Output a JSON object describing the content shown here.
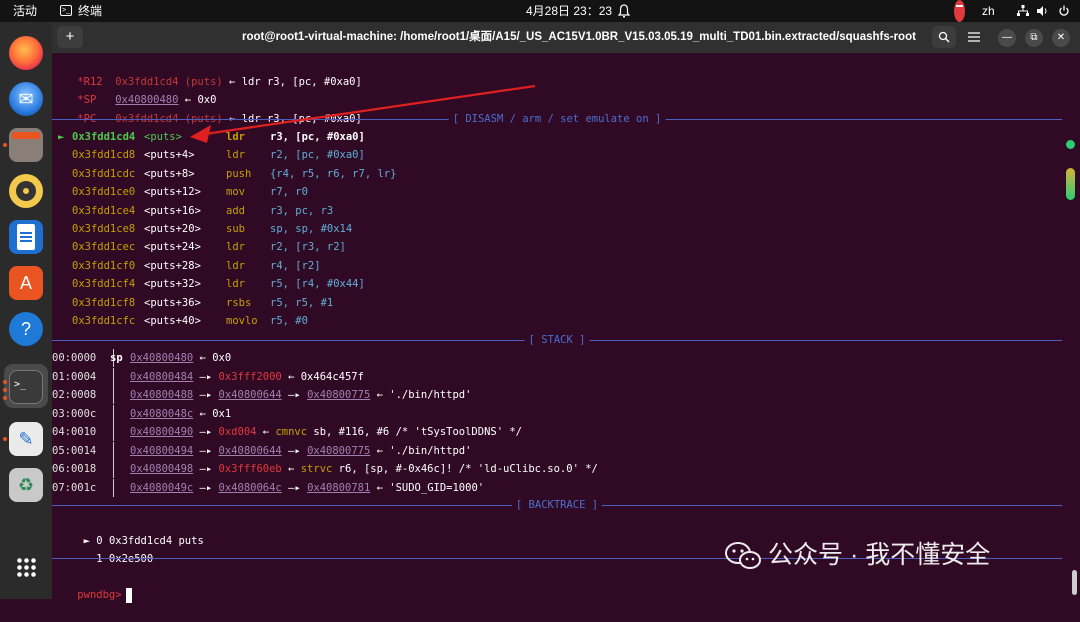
{
  "topbar": {
    "activities": "活动",
    "app_name": "终端",
    "clock": "4月28日 23：23",
    "lang": "zh"
  },
  "dock": {
    "items": [
      "firefox",
      "thunderbird",
      "files",
      "rhythmbox",
      "libreoffice-writer",
      "app-center",
      "help",
      "terminal",
      "text-editor",
      "trash",
      "show-apps"
    ]
  },
  "window": {
    "new_tab_icon": "+",
    "title": "root@root1-virtual-machine: /home/root1/桌面/A15/_US_AC15V1.0BR_V15.03.05.19_multi_TD01.bin.extracted/squashfs-root",
    "search_icon": "search-icon",
    "menu_icon": "hamburger-icon"
  },
  "registers": [
    {
      "name": "*R12",
      "addr": "0x3fdd1cd4 (puts)",
      "arrow": "←",
      "rest": "ldr r3, [pc, #0xa0]"
    },
    {
      "name": "*SP",
      "addr": "0x40800480",
      "arrow": "←",
      "rest": "0x0"
    },
    {
      "name": "*PC",
      "addr": "0x3fdd1cd4 (puts)",
      "arrow": "←",
      "rest": "ldr r3, [pc, #0xa0]"
    }
  ],
  "disasm": {
    "header": "[ DISASM / arm / set emulate on ]",
    "rows": [
      {
        "marker": "►",
        "addr": "0x3fdd1cd4",
        "sym": "<puts>",
        "op": "ldr",
        "args": "r3, [pc, #0xa0]",
        "current": true
      },
      {
        "marker": "",
        "addr": "0x3fdd1cd8",
        "sym": "<puts+4>",
        "op": "ldr",
        "args": "r2, [pc, #0xa0]",
        "current": false
      },
      {
        "marker": "",
        "addr": "0x3fdd1cdc",
        "sym": "<puts+8>",
        "op": "push",
        "args": "{r4, r5, r6, r7, lr}",
        "current": false
      },
      {
        "marker": "",
        "addr": "0x3fdd1ce0",
        "sym": "<puts+12>",
        "op": "mov",
        "args": "r7, r0",
        "current": false
      },
      {
        "marker": "",
        "addr": "0x3fdd1ce4",
        "sym": "<puts+16>",
        "op": "add",
        "args": "r3, pc, r3",
        "current": false
      },
      {
        "marker": "",
        "addr": "0x3fdd1ce8",
        "sym": "<puts+20>",
        "op": "sub",
        "args": "sp, sp, #0x14",
        "current": false
      },
      {
        "marker": "",
        "addr": "0x3fdd1cec",
        "sym": "<puts+24>",
        "op": "ldr",
        "args": "r2, [r3, r2]",
        "current": false
      },
      {
        "marker": "",
        "addr": "0x3fdd1cf0",
        "sym": "<puts+28>",
        "op": "ldr",
        "args": "r4, [r2]",
        "current": false
      },
      {
        "marker": "",
        "addr": "0x3fdd1cf4",
        "sym": "<puts+32>",
        "op": "ldr",
        "args": "r5, [r4, #0x44]",
        "current": false
      },
      {
        "marker": "",
        "addr": "0x3fdd1cf8",
        "sym": "<puts+36>",
        "op": "rsbs",
        "args": "r5, r5, #1",
        "current": false
      },
      {
        "marker": "",
        "addr": "0x3fdd1cfc",
        "sym": "<puts+40>",
        "op": "movlo",
        "args": "r5, #0",
        "current": false
      }
    ]
  },
  "stack": {
    "header": "[ STACK ]",
    "rows": [
      {
        "off": "00:0000",
        "reg": "sp",
        "a1": "0x40800480",
        "ar1": "←",
        "a2": "",
        "a2c": "",
        "ar2": "",
        "a3": "",
        "ar3": "",
        "tail": "0x0",
        "op": "",
        "args": ""
      },
      {
        "off": "01:0004",
        "reg": "",
        "a1": "0x40800484",
        "ar1": "—▸",
        "a2": "0x3fff2000",
        "a2c": "red",
        "ar2": "←",
        "a3": "",
        "ar3": "",
        "tail": "0x464c457f",
        "op": "",
        "args": ""
      },
      {
        "off": "02:0008",
        "reg": "",
        "a1": "0x40800488",
        "ar1": "—▸",
        "a2": "0x40800644",
        "a2c": "purple",
        "ar2": "—▸",
        "a3": "0x40800775",
        "ar3": "←",
        "tail": "'./bin/httpd'",
        "op": "",
        "args": ""
      },
      {
        "off": "03:000c",
        "reg": "",
        "a1": "0x4080048c",
        "ar1": "←",
        "a2": "",
        "a2c": "",
        "ar2": "",
        "a3": "",
        "ar3": "",
        "tail": "0x1",
        "op": "",
        "args": ""
      },
      {
        "off": "04:0010",
        "reg": "",
        "a1": "0x40800490",
        "ar1": "—▸",
        "a2": "0xd004",
        "a2c": "red",
        "ar2": "←",
        "a3": "",
        "ar3": "",
        "tail": "",
        "op": "cmnvc",
        "args": "sb, #116, #6 /* 'tSysToolDDNS' */"
      },
      {
        "off": "05:0014",
        "reg": "",
        "a1": "0x40800494",
        "ar1": "—▸",
        "a2": "0x40800644",
        "a2c": "purple",
        "ar2": "—▸",
        "a3": "0x40800775",
        "ar3": "←",
        "tail": "'./bin/httpd'",
        "op": "",
        "args": ""
      },
      {
        "off": "06:0018",
        "reg": "",
        "a1": "0x40800498",
        "ar1": "—▸",
        "a2": "0x3fff60eb",
        "a2c": "red",
        "ar2": "←",
        "a3": "",
        "ar3": "",
        "tail": "",
        "op": "strvc",
        "args": "r6, [sp, #-0x46c]! /* 'ld-uClibc.so.0' */"
      },
      {
        "off": "07:001c",
        "reg": "",
        "a1": "0x4080049c",
        "ar1": "—▸",
        "a2": "0x4080064c",
        "a2c": "purple",
        "ar2": "—▸",
        "a3": "0x40800781",
        "ar3": "←",
        "tail": "'SUDO_GID=1000'",
        "op": "",
        "args": ""
      }
    ]
  },
  "backtrace": {
    "header": "[ BACKTRACE ]",
    "rows": [
      {
        "marker": "►",
        "idx": "0",
        "addr": "0x3fdd1cd4",
        "sym": "puts"
      },
      {
        "marker": "",
        "idx": "1",
        "addr": "0x2e500",
        "sym": ""
      }
    ]
  },
  "prompt": "pwndbg>",
  "watermark": "公众号 · 我不懂安全",
  "colors": {
    "terminal_bg": "#300a24",
    "register_name": "#e0393e",
    "current_instruction": "#4ec94e",
    "mnemonic": "#c4a000",
    "section_header": "#4a6fd0",
    "annotation_arrow": "#e02020"
  }
}
